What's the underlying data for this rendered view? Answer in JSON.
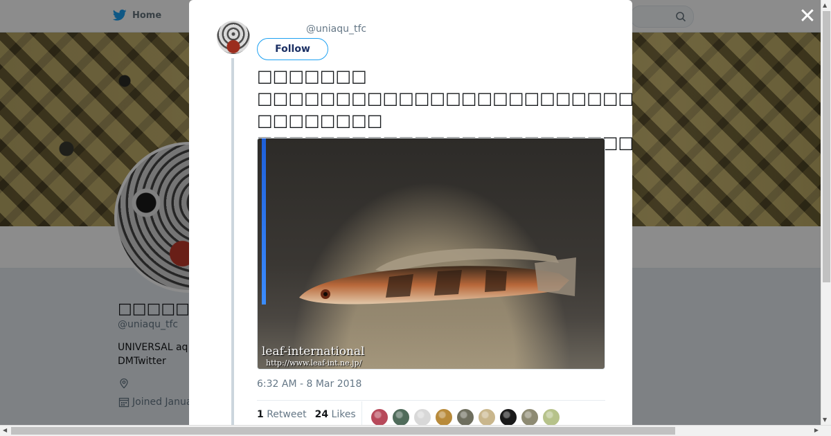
{
  "nav": {
    "home_label": "Home"
  },
  "profile": {
    "name": "□□□□□□□□□□",
    "handle": "@uniaqu_tfc",
    "bio_line1": "UNIVERSAL aq",
    "bio_line2": "DMTwitter",
    "joined": "Joined Janua"
  },
  "tweet": {
    "handle": "@uniaqu_tfc",
    "follow_label": "Follow",
    "text": "□□□□□□□\n□□□□□□□□□□□□□□□□□□□□□□□□□□□□□□□□□□□□□□□□□□□□\n□□□□□□□□□□□□□□□□□□□□□□□□□□□□□□□□□□□□□□□□ □□",
    "watermark_line1": "leaf-international",
    "watermark_line2": "http://www.leaf-int.ne.jp/",
    "timestamp": "6:32 AM - 8 Mar 2018",
    "retweets_count": "1",
    "retweets_label": "Retweet",
    "likes_count": "24",
    "likes_label": "Likes"
  },
  "liker_avatar_colors": [
    "#b7495a",
    "#4f6b5a",
    "#d8d8d8",
    "#b88a3a",
    "#6e6e5e",
    "#c9b68c",
    "#1a1a1a",
    "#8d8a72",
    "#b6c28a"
  ],
  "colors": {
    "accent": "#1da1f2",
    "follow_text": "#1b2f63"
  },
  "icons": [
    "twitter-bird-icon",
    "search-icon",
    "close-icon",
    "location-icon",
    "calendar-icon"
  ]
}
